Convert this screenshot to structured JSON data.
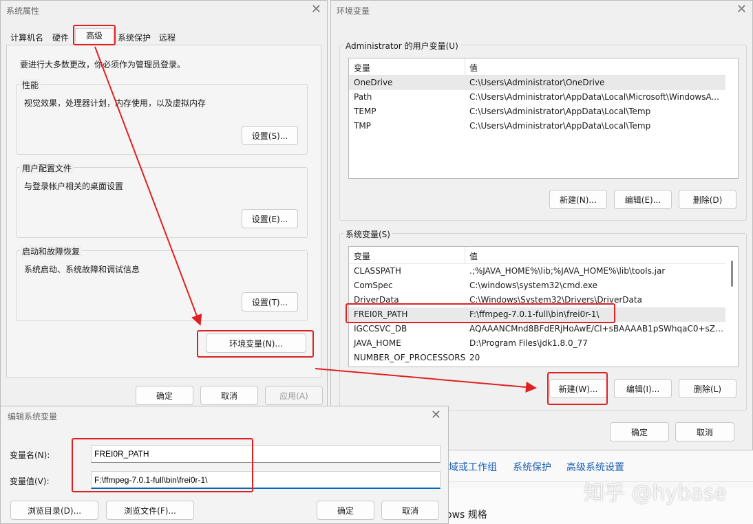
{
  "sys_props": {
    "title": "系统属性",
    "tabs": [
      "计算机名",
      "硬件",
      "高级",
      "系统保护",
      "远程"
    ],
    "admin_note": "要进行大多数更改，你必须作为管理员登录。",
    "perf": {
      "label": "性能",
      "desc": "视觉效果，处理器计划，内存使用，以及虚拟内存",
      "btn": "设置(S)..."
    },
    "profile": {
      "label": "用户配置文件",
      "desc": "与登录帐户相关的桌面设置",
      "btn": "设置(E)..."
    },
    "startup": {
      "label": "启动和故障恢复",
      "desc": "系统启动、系统故障和调试信息",
      "btn": "设置(T)..."
    },
    "env_btn": "环境变量(N)...",
    "ok": "确定",
    "cancel": "取消",
    "apply": "应用(A)"
  },
  "env": {
    "title": "环境变量",
    "user_group": "Administrator 的用户变量(U)",
    "sys_group": "系统变量(S)",
    "col_var": "变量",
    "col_val": "值",
    "user_vars": [
      {
        "name": "OneDrive",
        "value": "C:\\Users\\Administrator\\OneDrive"
      },
      {
        "name": "Path",
        "value": "C:\\Users\\Administrator\\AppData\\Local\\Microsoft\\WindowsA..."
      },
      {
        "name": "TEMP",
        "value": "C:\\Users\\Administrator\\AppData\\Local\\Temp"
      },
      {
        "name": "TMP",
        "value": "C:\\Users\\Administrator\\AppData\\Local\\Temp"
      }
    ],
    "sys_vars": [
      {
        "name": "CLASSPATH",
        "value": ".;%JAVA_HOME%\\lib;%JAVA_HOME%\\lib\\tools.jar"
      },
      {
        "name": "ComSpec",
        "value": "C:\\windows\\system32\\cmd.exe"
      },
      {
        "name": "DriverData",
        "value": "C:\\Windows\\System32\\Drivers\\DriverData"
      },
      {
        "name": "FREI0R_PATH",
        "value": "F:\\ffmpeg-7.0.1-full\\bin\\frei0r-1\\"
      },
      {
        "name": "IGCCSVC_DB",
        "value": "AQAAANCMnd8BFdERjHoAwE/Cl+sBAAAAB1pSWhqaC0+sZe..."
      },
      {
        "name": "JAVA_HOME",
        "value": "D:\\Program Files\\jdk1.8.0_77"
      },
      {
        "name": "NUMBER_OF_PROCESSORS",
        "value": "20"
      }
    ],
    "user_btns": {
      "new": "新建(N)...",
      "edit": "编辑(E)...",
      "del": "删除(D)"
    },
    "sys_btns": {
      "new": "新建(W)...",
      "edit": "编辑(I)...",
      "del": "删除(L)"
    },
    "ok": "确定",
    "cancel": "取消"
  },
  "edit": {
    "title": "编辑系统变量",
    "name_label": "变量名(N):",
    "value_label": "变量值(V):",
    "name_value": "FREI0R_PATH",
    "value_value": "F:\\ffmpeg-7.0.1-full\\bin\\frei0r-1\\",
    "browse_dir": "浏览目录(D)...",
    "browse_file": "浏览文件(F)...",
    "ok": "确定",
    "cancel": "取消"
  },
  "bg": {
    "links": [
      "域或工作组",
      "系统保护",
      "高级系统设置"
    ],
    "spec_text": "ows 规格"
  },
  "watermark": "知乎 @hybase",
  "colors": {
    "highlight": "#e02020",
    "accent": "#0067c0"
  }
}
